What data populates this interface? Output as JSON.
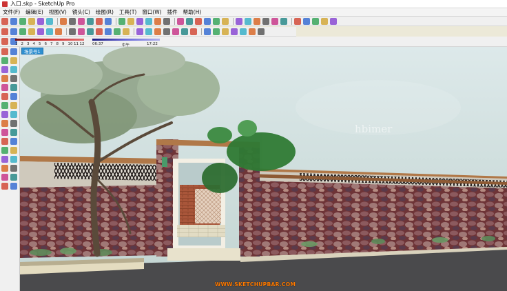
{
  "window": {
    "title": "入口.skp - SketchUp Pro"
  },
  "menu": [
    "文件(F)",
    "编辑(E)",
    "视图(V)",
    "镜头(C)",
    "绘图(R)",
    "工具(T)",
    "窗口(W)",
    "插件",
    "帮助(H)"
  ],
  "toolbars": {
    "row1": [
      "select-icon",
      "pencil-icon",
      "rectangle-icon",
      "circle-icon",
      "arc-icon",
      "polygon-icon",
      "eraser-icon",
      "paint-bucket-icon",
      "push-pull-icon",
      "move-icon",
      "rotate-icon",
      "scale-icon",
      "offset-icon",
      "tape-icon",
      "text-icon",
      "axes-icon",
      "orbit-icon",
      "pan-icon",
      "zoom-icon",
      "zoom-window-icon",
      "zoom-extents-icon",
      "previous-view-icon",
      "next-view-icon",
      "iso-view-icon",
      "top-view-icon",
      "front-view-icon",
      "right-view-icon",
      "back-view-icon",
      "left-view-icon",
      "xray-icon",
      "wireframe-icon",
      "hidden-line-icon",
      "shaded-icon",
      "textured-icon",
      "monochrome-icon"
    ],
    "row2": [
      "component-icon",
      "group-icon",
      "section-plane-icon",
      "follow-me-icon",
      "intersect-icon",
      "union-icon",
      "subtract-icon",
      "trim-icon",
      "split-icon",
      "outer-shell-icon",
      "sandbox-smoove-icon",
      "sandbox-stamp-icon",
      "sandbox-drape-icon",
      "sandbox-add-detail-icon",
      "sandbox-flip-edge-icon",
      "walk-icon",
      "look-around-icon",
      "position-camera-icon",
      "dimension-icon",
      "protractor-icon",
      "3d-text-icon",
      "geo-location-icon",
      "photo-match-icon",
      "layers-icon",
      "warehouse-icon",
      "extension-icon",
      "style-icon",
      "ruby-icon"
    ],
    "row3": [
      "shadow-toggle-icon",
      "fog-icon"
    ]
  },
  "shadow_bar": {
    "month_labels": [
      "1",
      "2",
      "3",
      "4",
      "5",
      "6",
      "7",
      "8",
      "9",
      "10",
      "11",
      "12"
    ],
    "time_start": "06:37",
    "time_mid": "中午",
    "time_end": "17:22"
  },
  "left_tools": [
    [
      "select-icon",
      "lasso-icon"
    ],
    [
      "paint-icon",
      "eraser-icon"
    ],
    [
      "rectangle-icon",
      "pencil-icon"
    ],
    [
      "circle-icon",
      "arc-icon"
    ],
    [
      "polygon-icon",
      "freehand-icon"
    ],
    [
      "move-icon",
      "push-pull-icon"
    ],
    [
      "rotate-icon",
      "follow-me-icon"
    ],
    [
      "scale-icon",
      "offset-icon"
    ],
    [
      "tape-icon",
      "dimension-icon"
    ],
    [
      "protractor-icon",
      "text-icon"
    ],
    [
      "axes-icon",
      "3d-text-icon"
    ],
    [
      "orbit-icon",
      "pan-icon"
    ],
    [
      "zoom-icon",
      "zoom-window-icon"
    ],
    [
      "zoom-extents-icon",
      "previous-icon"
    ],
    [
      "position-camera-icon",
      "look-around-icon"
    ],
    [
      "walk-icon",
      "section-icon"
    ]
  ],
  "viewport": {
    "scene_tab": "场景号1",
    "watermark": "hbimer",
    "site_credit": "WWW.SKETCHUPBAR.COM"
  },
  "colors": {
    "scene_tab": "#2f8fd0",
    "sky_top": "#d8e6e8",
    "sky_bottom": "#c4d6d3",
    "wall_stone": "#7a3a3a",
    "road": "#4a4a4c"
  }
}
